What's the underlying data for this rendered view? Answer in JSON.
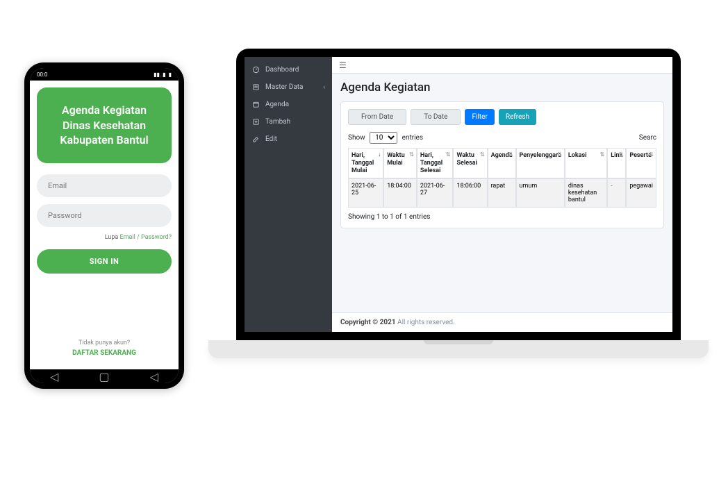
{
  "phone": {
    "statusbar": {
      "time": "00:0",
      "signal": "📶",
      "battery": "■"
    },
    "title": "Agenda Kegiatan Dinas Kesehatan Kabupaten Bantul",
    "email_placeholder": "Email",
    "password_placeholder": "Password",
    "forgot_prefix": "Lupa ",
    "forgot_link": "Email / Password?",
    "signin_label": "SIGN IN",
    "no_account": "Tidak punya akun?",
    "register_label": "DAFTAR SEKARANG"
  },
  "sidebar": {
    "items": [
      {
        "icon": "dashboard",
        "label": "Dashboard"
      },
      {
        "icon": "data",
        "label": "Master Data",
        "has_children": true
      },
      {
        "icon": "agenda",
        "label": "Agenda"
      },
      {
        "icon": "add",
        "label": "Tambah"
      },
      {
        "icon": "edit",
        "label": "Edit"
      }
    ]
  },
  "main": {
    "page_title": "Agenda Kegiatan",
    "filters": {
      "from_date": "From Date",
      "to_date": "To Date",
      "filter_btn": "Filter",
      "refresh_btn": "Refresh"
    },
    "table_controls": {
      "show_label": "Show",
      "entries_value": "10",
      "entries_label": "entries",
      "search_label": "Searc"
    },
    "columns": [
      "Hari, Tanggal Mulai",
      "Waktu Mulai",
      "Hari, Tanggal Selesai",
      "Waktu Selesai",
      "Agenda",
      "Penyelenggara",
      "Lokasi",
      "Link",
      "Peserta"
    ],
    "rows": [
      {
        "tgl_mulai": "2021-06-25",
        "waktu_mulai": "18:04:00",
        "tgl_selesai": "2021-06-27",
        "waktu_selesai": "18:06:00",
        "agenda": "rapat",
        "penyelenggara": "umum",
        "lokasi": "dinas kesehatan bantul",
        "link": "-",
        "peserta": "pegawai"
      }
    ],
    "table_info": "Showing 1 to 1 of 1 entries"
  },
  "footer": {
    "copyright_bold": "Copyright © 2021",
    "copyright_rest": " All rights reserved."
  }
}
